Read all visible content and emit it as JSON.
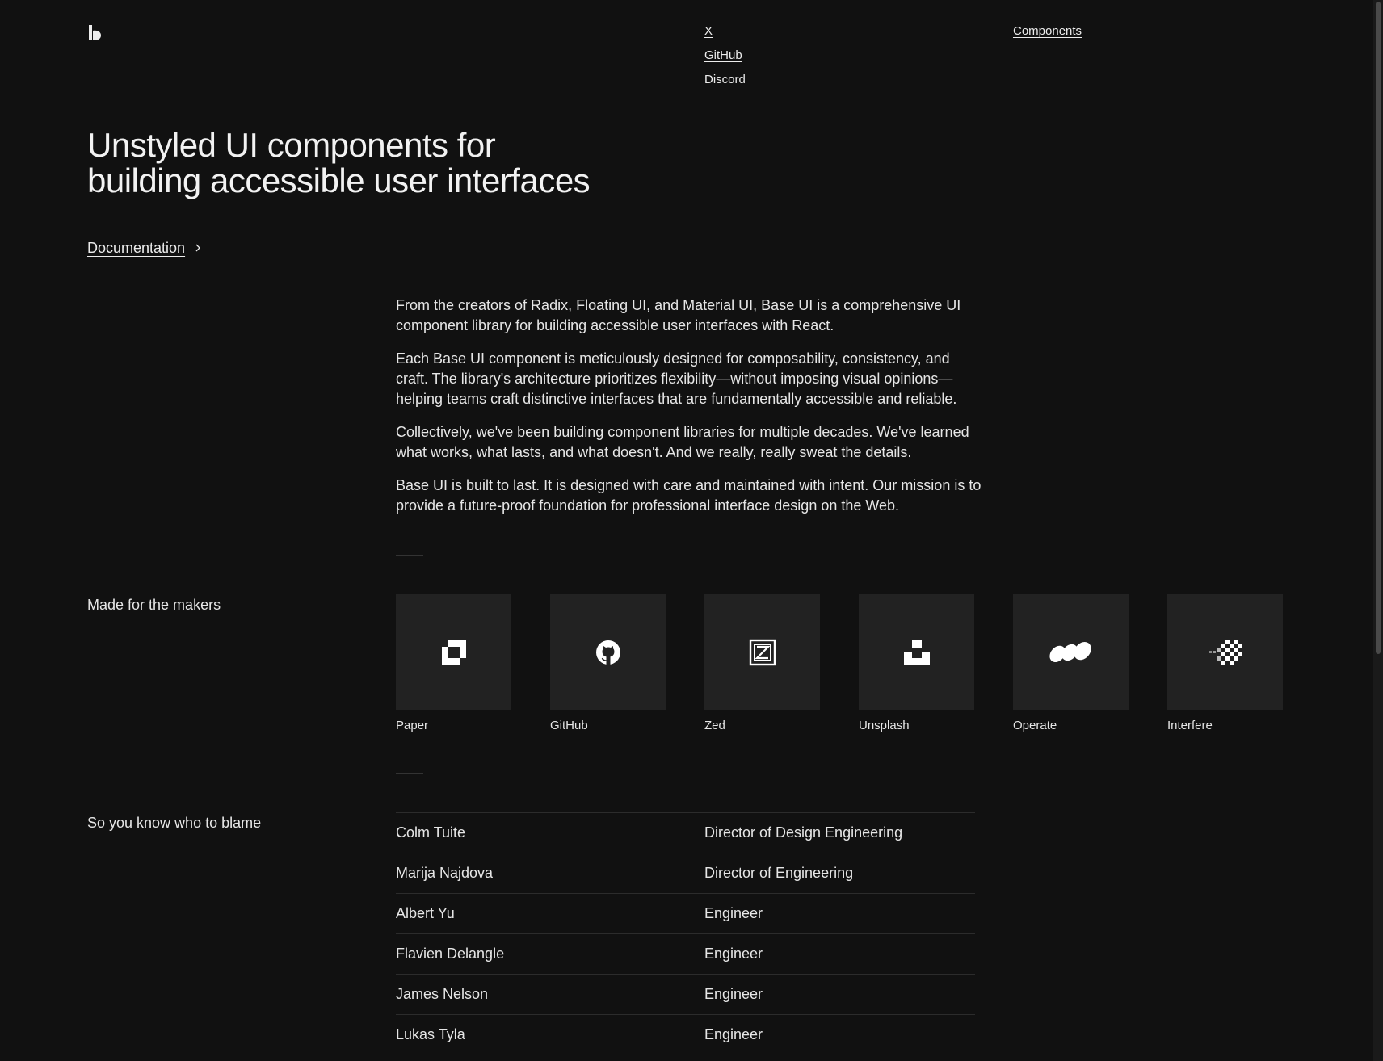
{
  "header": {
    "external_links": [
      "X",
      "GitHub",
      "Discord"
    ],
    "nav_links": [
      "Components"
    ]
  },
  "hero": {
    "title_line1": "Unstyled UI components for",
    "title_line2": "building accessible user interfaces",
    "doc_link_label": "Documentation"
  },
  "intro": {
    "paragraphs": [
      "From the creators of Radix, Floating UI, and Material UI, Base UI is a comprehensive UI component library for building accessible user interfaces with React.",
      "Each Base UI component is meticulously designed for composability, consistency, and craft. The library's architecture prioritizes flexibility—without imposing visual opinions—helping teams craft distinctive interfaces that are fundamentally accessible and reliable.",
      "Collectively, we've been building component libraries for multiple decades. We've learned what works, what lasts, and what doesn't. And we really, really sweat the details.",
      "Base UI is built to last. It is designed with care and maintained with intent. Our mission is to provide a future-proof foundation for professional interface design on the Web."
    ]
  },
  "makers": {
    "label": "Made for the makers",
    "items": [
      {
        "name": "Paper",
        "icon": "paper-logo-icon"
      },
      {
        "name": "GitHub",
        "icon": "github-logo-icon"
      },
      {
        "name": "Zed",
        "icon": "zed-logo-icon"
      },
      {
        "name": "Unsplash",
        "icon": "unsplash-logo-icon"
      },
      {
        "name": "Operate",
        "icon": "operate-logo-icon"
      },
      {
        "name": "Interfere",
        "icon": "interfere-logo-icon"
      }
    ]
  },
  "team": {
    "label": "So you know who to blame",
    "members": [
      {
        "name": "Colm Tuite",
        "role": "Director of Design Engineering"
      },
      {
        "name": "Marija Najdova",
        "role": "Director of Engineering"
      },
      {
        "name": "Albert Yu",
        "role": "Engineer"
      },
      {
        "name": "Flavien Delangle",
        "role": "Engineer"
      },
      {
        "name": "James Nelson",
        "role": "Engineer"
      },
      {
        "name": "Lukas Tyla",
        "role": "Engineer"
      }
    ]
  },
  "colors": {
    "background": "#111111",
    "text": "#ececec",
    "tile": "#222222",
    "rule": "#2c2c2c"
  }
}
